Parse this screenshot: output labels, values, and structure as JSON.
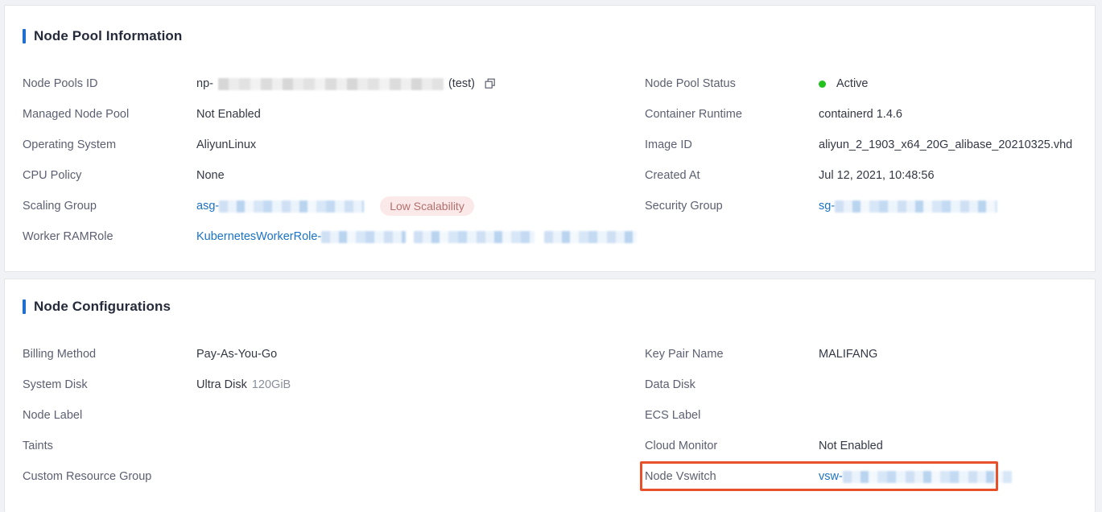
{
  "theme": {
    "accent_blue": "#1f6fd0",
    "link_blue": "#1a73c8",
    "status_green": "#22c11e",
    "highlight_red": "#e8502a",
    "badge_bg": "#fae9e8",
    "badge_text": "#b3706e"
  },
  "sections": [
    {
      "id": "node-pool-information",
      "title": "Node Pool Information",
      "left_rows": [
        {
          "label": "Node Pools ID",
          "value_prefix": "np-",
          "redacted": true,
          "redact_style": "gray",
          "redact_width": 280,
          "value_suffix": "(test)",
          "copy_icon": "copy-icon"
        },
        {
          "label": "Managed Node Pool",
          "value": "Not Enabled"
        },
        {
          "label": "Operating System",
          "value": "AliyunLinux"
        },
        {
          "label": "CPU Policy",
          "value": "None"
        },
        {
          "label": "Scaling Group",
          "value_prefix": "asg-",
          "link": true,
          "redacted": true,
          "redact_style": "blue",
          "redact_width": 180,
          "badge": "Low Scalability"
        },
        {
          "label": "Worker RAMRole",
          "value_prefix": "KubernetesWorkerRole-",
          "link": true,
          "redacted": true,
          "redact_style": "blue",
          "redact_groups": [
            105,
            150,
            115
          ],
          "redact_width": 0
        }
      ],
      "right_rows": [
        {
          "label": "Node Pool Status",
          "value": "Active",
          "status_dot": true
        },
        {
          "label": "Container Runtime",
          "value": "containerd 1.4.6"
        },
        {
          "label": "Image ID",
          "value": "aliyun_2_1903_x64_20G_alibase_20210325.vhd"
        },
        {
          "label": "Created At",
          "value": "Jul 12, 2021, 10:48:56"
        },
        {
          "label": "Security Group",
          "value_prefix": "sg-",
          "link": true,
          "redacted": true,
          "redact_style": "blue",
          "redact_width": 202
        }
      ]
    },
    {
      "id": "node-configurations",
      "title": "Node Configurations",
      "left_rows": [
        {
          "label": "Billing Method",
          "value": "Pay-As-You-Go"
        },
        {
          "label": "System Disk",
          "value": "Ultra Disk",
          "value_sub": "120GiB"
        },
        {
          "label": "Node Label",
          "value": ""
        },
        {
          "label": "Taints",
          "value": ""
        },
        {
          "label": "Custom Resource Group",
          "value": ""
        }
      ],
      "right_rows": [
        {
          "label": "Key Pair Name",
          "value": "MALIFANG"
        },
        {
          "label": "Data Disk",
          "value": ""
        },
        {
          "label": "ECS Label",
          "value": ""
        },
        {
          "label": "Cloud Monitor",
          "value": "Not Enabled"
        },
        {
          "label": "Node Vswitch",
          "value_prefix": "vsw-",
          "link": true,
          "redacted": true,
          "redact_style": "blue",
          "redact_width": 210,
          "highlighted": true
        }
      ]
    }
  ]
}
